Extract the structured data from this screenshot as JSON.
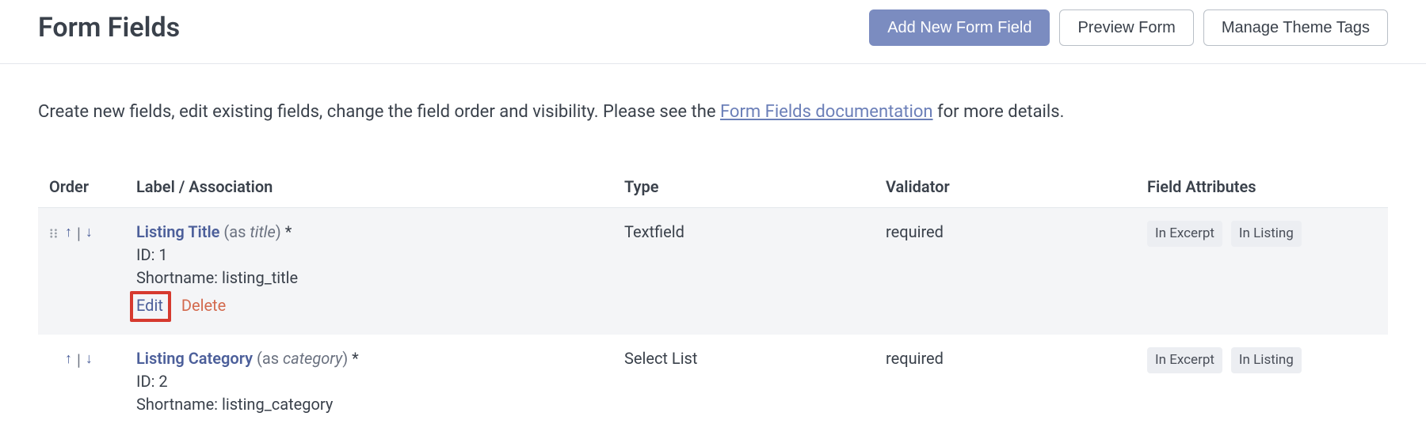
{
  "header": {
    "title": "Form Fields",
    "add_button": "Add New Form Field",
    "preview_button": "Preview Form",
    "manage_button": "Manage Theme Tags"
  },
  "intro": {
    "prefix": "Create new fields, edit existing fields, change the field order and visibility. Please see the ",
    "link_text": "Form Fields documentation",
    "suffix": " for more details."
  },
  "table": {
    "headers": {
      "order": "Order",
      "label": "Label / Association",
      "type": "Type",
      "validator": "Validator",
      "attrs": "Field Attributes"
    },
    "rows": [
      {
        "name": "Listing Title",
        "as_open": " (as ",
        "as_val": "title",
        "as_close": ") ",
        "star": "*",
        "id_line": "ID: 1",
        "shortname_line": "Shortname: listing_title",
        "edit": "Edit",
        "delete": "Delete",
        "type": "Textfield",
        "validator": "required",
        "badge1": "In Excerpt",
        "badge2": "In Listing"
      },
      {
        "name": "Listing Category",
        "as_open": " (as ",
        "as_val": "category",
        "as_close": ") ",
        "star": "*",
        "id_line": "ID: 2",
        "shortname_line": "Shortname: listing_category",
        "type": "Select List",
        "validator": "required",
        "badge1": "In Excerpt",
        "badge2": "In Listing"
      }
    ]
  },
  "glyphs": {
    "up": "↑",
    "down": "↓",
    "pipe": "|"
  }
}
